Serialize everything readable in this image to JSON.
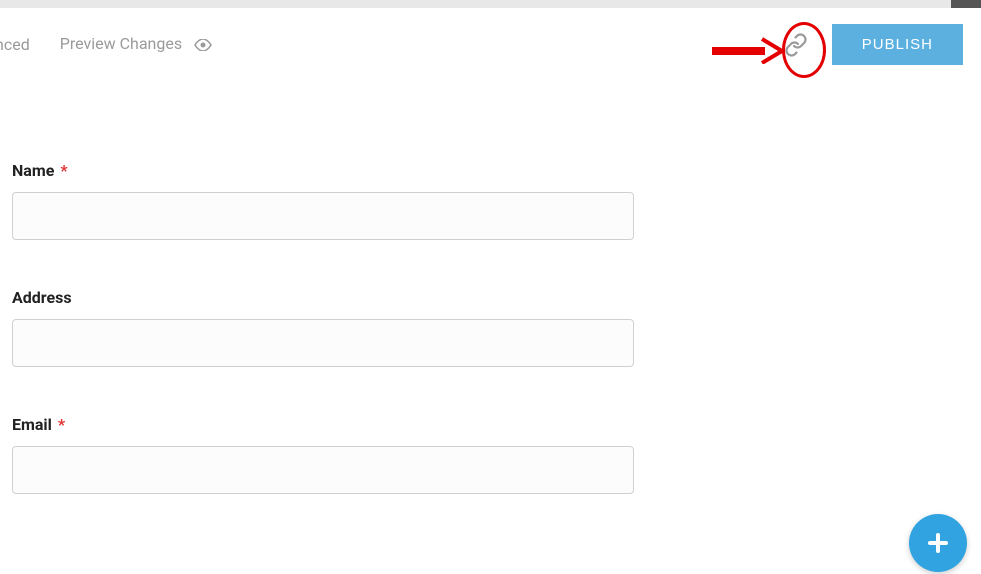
{
  "header": {
    "tab_cut": "nced",
    "preview_label": "Preview Changes",
    "publish_label": "PUBLISH"
  },
  "form": {
    "fields": [
      {
        "label": "Name",
        "required": true
      },
      {
        "label": "Address",
        "required": false
      },
      {
        "label": "Email",
        "required": true
      }
    ]
  }
}
